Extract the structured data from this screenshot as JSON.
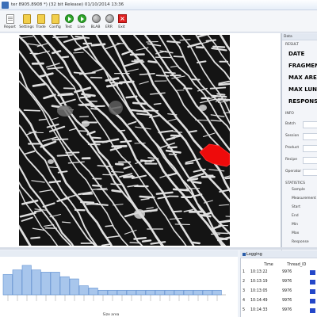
{
  "window": {
    "title": "ter 8905.8908 *) (32 bit Release) 01/10/2014 13:36"
  },
  "toolbar": {
    "buttons": [
      {
        "label": "Report",
        "icon": "report-icon"
      },
      {
        "label": "Settings",
        "icon": "settings-icon"
      },
      {
        "label": "Trade",
        "icon": "trade-icon"
      },
      {
        "label": "Config",
        "icon": "config-icon"
      },
      {
        "label": "Test",
        "icon": "test-icon"
      },
      {
        "label": "Live",
        "icon": "live-icon"
      },
      {
        "label": "BLAB",
        "icon": "blab-icon"
      },
      {
        "label": "ERR",
        "icon": "err-icon"
      },
      {
        "label": "Exit",
        "icon": "exit-icon"
      }
    ]
  },
  "right_panel": {
    "header": "Data",
    "result_label": "RESULT",
    "results": [
      "DATE",
      "FRAGMENT",
      "MAX AREA",
      "MAX LUNG",
      "RESPONSE"
    ],
    "info_label": "INFO",
    "info_fields": [
      "Batch",
      "Session",
      "Product",
      "Recipe",
      "Operator"
    ],
    "statistics_label": "STATISTICS",
    "statistics_fields": [
      "Sample",
      "Measurement",
      "Start",
      "End",
      "Min",
      "Max",
      "Response"
    ]
  },
  "histogram": {
    "xlabel": "Size area",
    "colors": {
      "bar_fill": "#a8c6ec",
      "bar_stroke": "#5f8fd0"
    }
  },
  "chart_data": {
    "type": "bar",
    "xlabel": "Size area",
    "values": [
      9,
      11,
      13,
      11,
      10,
      10,
      8,
      7,
      4,
      3,
      2,
      2,
      2,
      2,
      2,
      2,
      2,
      2,
      2,
      2,
      2,
      2,
      2
    ],
    "ylim": [
      0,
      14
    ]
  },
  "logging": {
    "title": "Logging",
    "columns": [
      "Time",
      "Thread_ID"
    ],
    "rows": [
      {
        "n": "1",
        "time": "10:13:22",
        "thread": "9976"
      },
      {
        "n": "2",
        "time": "10:13:19",
        "thread": "9976"
      },
      {
        "n": "3",
        "time": "10:13:05",
        "thread": "9976"
      },
      {
        "n": "4",
        "time": "10:14:49",
        "thread": "9976"
      },
      {
        "n": "5",
        "time": "10:14:33",
        "thread": "9976"
      }
    ]
  },
  "colors": {
    "highlight_red": "#ee0b0b",
    "toolbar_bg": "#f4f6f9",
    "log_flag": "#2447c9"
  }
}
